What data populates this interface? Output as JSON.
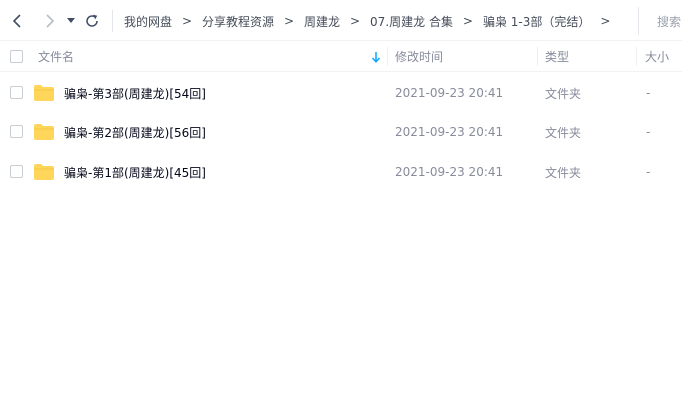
{
  "toolbar": {
    "back_icon": "chevron-left-icon",
    "forward_icon": "chevron-right-icon",
    "history_icon": "caret-down-icon",
    "refresh_icon": "refresh-icon"
  },
  "breadcrumb": {
    "items": [
      "我的网盘",
      "分享教程资源",
      "周建龙",
      "07.周建龙 合集",
      "骗枭 1-3部（完结）"
    ],
    "separator": ">"
  },
  "search": {
    "placeholder": "搜索"
  },
  "columns": {
    "name": "文件名",
    "modified": "修改时间",
    "type": "类型",
    "size": "大小"
  },
  "files": [
    {
      "name": "骗枭-第3部(周建龙)[54回]",
      "modified": "2021-09-23 20:41",
      "type": "文件夹",
      "size": "-"
    },
    {
      "name": "骗枭-第2部(周建龙)[56回]",
      "modified": "2021-09-23 20:41",
      "type": "文件夹",
      "size": "-"
    },
    {
      "name": "骗枭-第1部(周建龙)[45回]",
      "modified": "2021-09-23 20:41",
      "type": "文件夹",
      "size": "-"
    }
  ],
  "colors": {
    "folder": "#ffd659",
    "sort_arrow": "#06a7ff",
    "text": "#03081a",
    "muted": "#878c9c"
  }
}
